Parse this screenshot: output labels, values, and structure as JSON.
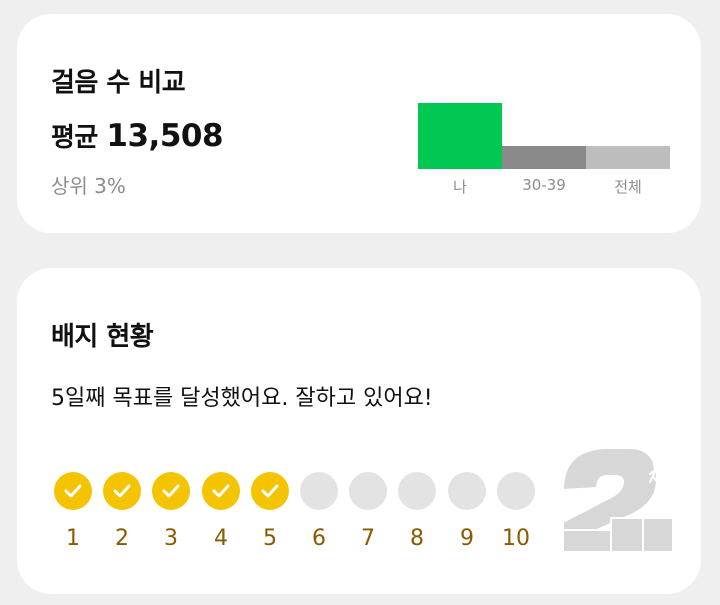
{
  "steps_card": {
    "title": "걸음 수 비교",
    "avg_prefix": "평균",
    "avg_value": "13,508",
    "rank_label": "상위 3%",
    "bars": [
      {
        "label": "나",
        "color": "#00c853",
        "value": 100
      },
      {
        "label": "30-39",
        "color": "#8a8a8a",
        "value": 35
      },
      {
        "label": "전체",
        "color": "#bdbdbd",
        "value": 35
      }
    ]
  },
  "badges_card": {
    "title": "배지 현황",
    "message": "5일째 목표를 달성했어요. 잘하고 있어요!",
    "days": [
      {
        "label": "1",
        "done": true
      },
      {
        "label": "2",
        "done": true
      },
      {
        "label": "3",
        "done": true
      },
      {
        "label": "4",
        "done": true
      },
      {
        "label": "5",
        "done": true
      },
      {
        "label": "6",
        "done": false
      },
      {
        "label": "7",
        "done": false
      },
      {
        "label": "8",
        "done": false
      },
      {
        "label": "9",
        "done": false
      },
      {
        "label": "10",
        "done": false
      }
    ],
    "badge_icon": "walker-badge-icon"
  },
  "colors": {
    "done": "#f5c400",
    "todo": "#e3e3e3",
    "day_label": "#8a5a00",
    "accent_green": "#00c853"
  }
}
